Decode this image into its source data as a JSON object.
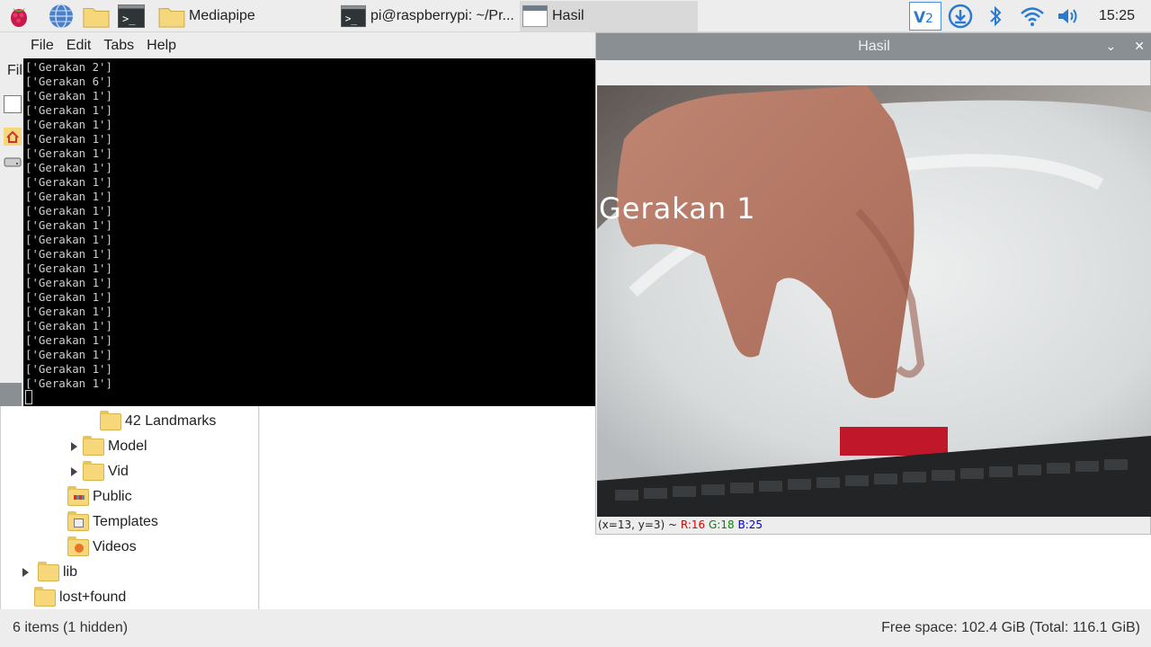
{
  "taskbar": {
    "tasks": [
      {
        "label": "Mediapipe",
        "icon": "folder-icon"
      },
      {
        "label": "pi@raspberrypi: ~/Pr...",
        "icon": "terminal-icon"
      },
      {
        "label": "Hasil",
        "icon": "window-icon"
      }
    ],
    "clock": "15:25"
  },
  "terminal": {
    "menu": [
      "File",
      "Edit",
      "Tabs",
      "Help"
    ],
    "lines": [
      "['Gerakan 2']",
      "['Gerakan 6']",
      "['Gerakan 1']",
      "['Gerakan 1']",
      "['Gerakan 1']",
      "['Gerakan 1']",
      "['Gerakan 1']",
      "['Gerakan 1']",
      "['Gerakan 1']",
      "['Gerakan 1']",
      "['Gerakan 1']",
      "['Gerakan 1']",
      "['Gerakan 1']",
      "['Gerakan 1']",
      "['Gerakan 1']",
      "['Gerakan 1']",
      "['Gerakan 1']",
      "['Gerakan 1']",
      "['Gerakan 1']",
      "['Gerakan 1']",
      "['Gerakan 1']",
      "['Gerakan 1']",
      "['Gerakan 1']"
    ]
  },
  "file_manager": {
    "partial_menu": "Fil",
    "tree": [
      {
        "label": "42 Landmarks",
        "expander": false
      },
      {
        "label": "Model",
        "expander": true
      },
      {
        "label": "Vid",
        "expander": true
      },
      {
        "label": "Public",
        "expander": false
      },
      {
        "label": "Templates",
        "expander": false
      },
      {
        "label": "Videos",
        "expander": false
      },
      {
        "label": "lib",
        "expander": true
      },
      {
        "label": "lost+found",
        "expander": false
      }
    ],
    "status_left": "6 items (1 hidden)",
    "status_right": "Free space: 102.4 GiB (Total: 116.1 GiB)"
  },
  "hasil": {
    "title": "Hasil",
    "overlay_text": "Gerakan 1",
    "status": {
      "prefix": "(x=13, y=3) ~",
      "r": "R:16",
      "g": "G:18",
      "b": "B:25"
    }
  },
  "colors": {
    "accent": "#8a8f94",
    "folder": "#f6d77a"
  }
}
